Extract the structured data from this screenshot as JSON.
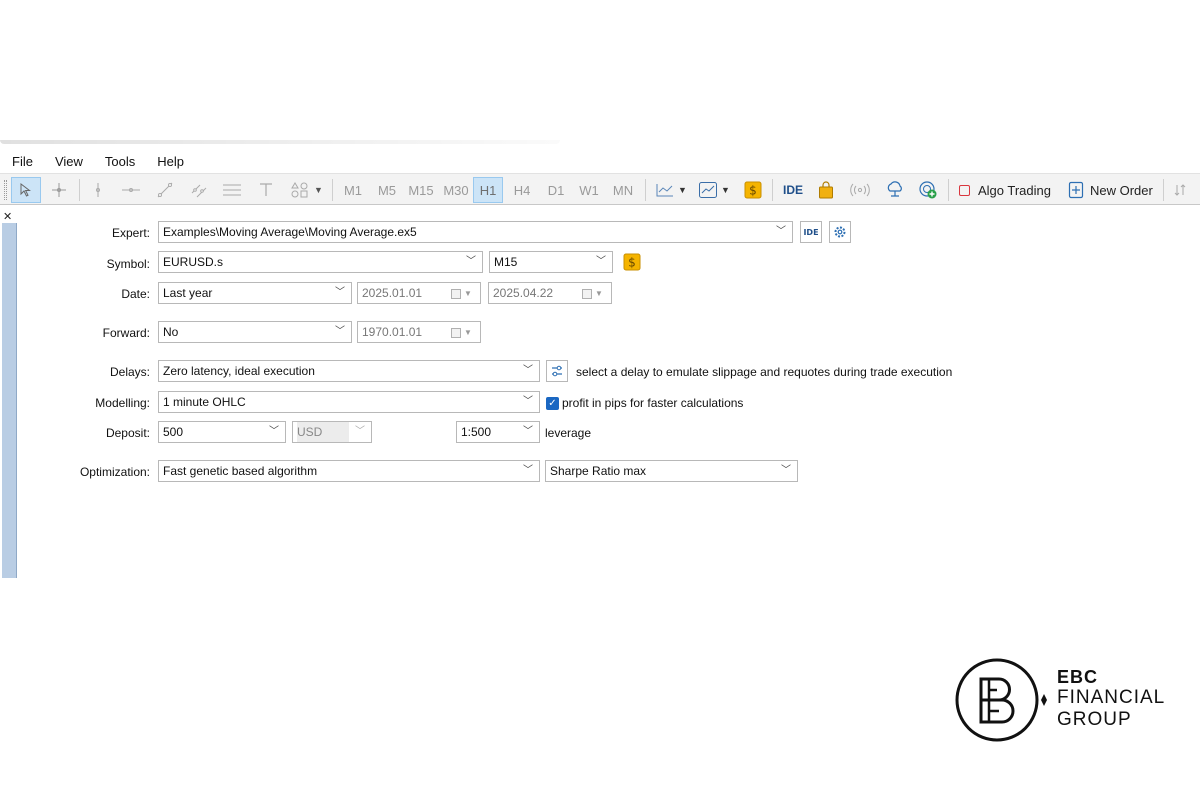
{
  "menu": [
    "File",
    "View",
    "Tools",
    "Help"
  ],
  "timeframes": [
    "M1",
    "M5",
    "M15",
    "M30",
    "H1",
    "H4",
    "D1",
    "W1",
    "MN"
  ],
  "active_timeframe": "H1",
  "toolbar": {
    "ide_label": "IDE",
    "algo_label": "Algo Trading",
    "new_order_label": "New Order"
  },
  "form": {
    "expert": {
      "label": "Expert:",
      "value": "Examples\\Moving Average\\Moving Average.ex5",
      "ide": "IDE"
    },
    "symbol": {
      "label": "Symbol:",
      "value": "EURUSD.s",
      "period": "M15"
    },
    "date": {
      "label": "Date:",
      "value": "Last year",
      "from": "2025.01.01",
      "to": "2025.04.22"
    },
    "forward": {
      "label": "Forward:",
      "value": "No",
      "date": "1970.01.01"
    },
    "delays": {
      "label": "Delays:",
      "value": "Zero latency, ideal execution",
      "hint": "select a delay to emulate slippage and requotes during trade execution"
    },
    "modelling": {
      "label": "Modelling:",
      "value": "1 minute OHLC",
      "checkbox_label": "profit in pips for faster calculations",
      "checked": true
    },
    "deposit": {
      "label": "Deposit:",
      "value": "500",
      "currency": "USD",
      "leverage": "1:500",
      "leverage_label": "leverage"
    },
    "optimization": {
      "label": "Optimization:",
      "value": "Fast genetic based algorithm",
      "criterion": "Sharpe Ratio max"
    }
  },
  "logo": {
    "line1": "EBC",
    "line2": "FINANCIAL",
    "line3": "GROUP"
  },
  "colors": {
    "accent": "#1a67c2",
    "active_tf_bg": "#cce4f7",
    "coin": "#f5b400",
    "algo_red": "#d9363e"
  }
}
